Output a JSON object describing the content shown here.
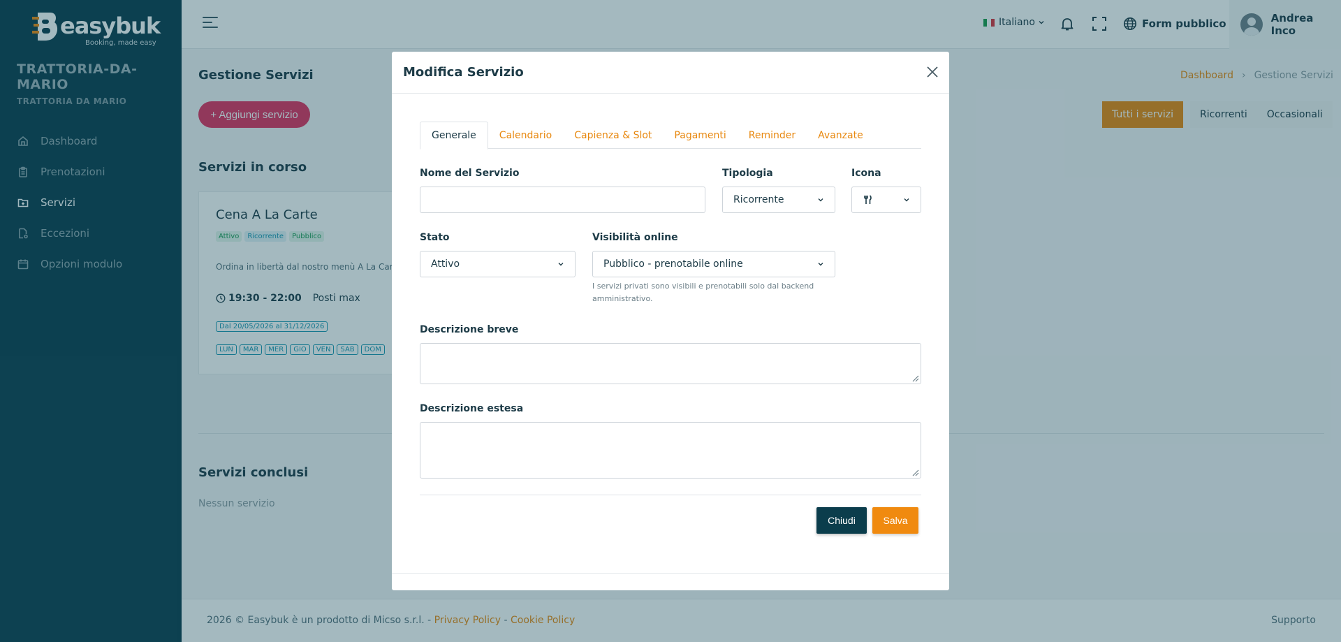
{
  "brand": {
    "logo_word": "easybuk",
    "tagline": "Booking, made easy",
    "org_title": "TRATTORIA-DA-MARIO",
    "org_subtitle": "TRATTORIA DA MARIO"
  },
  "sidebar": {
    "items": [
      {
        "label": "Dashboard",
        "icon": "home-icon"
      },
      {
        "label": "Prenotazioni",
        "icon": "clipboard-icon"
      },
      {
        "label": "Servizi",
        "icon": "folder-add-icon"
      },
      {
        "label": "Eccezioni",
        "icon": "file-gear-icon"
      },
      {
        "label": "Opzioni modulo",
        "icon": "calendar-icon"
      }
    ],
    "active": "Servizi"
  },
  "topbar": {
    "language": "Italiano",
    "public_form": "Form pubblico",
    "user_name": "Andrea Inco"
  },
  "page": {
    "title": "Gestione Servizi",
    "breadcrumb": {
      "home": "Dashboard",
      "current": "Gestione Servizi"
    },
    "add_button": "+ Aggiungi servizio",
    "filters": [
      "Tutti i servizi",
      "Ricorrenti",
      "Occasionali"
    ],
    "section_active": "Servizi in corso",
    "section_done": "Servizi conclusi",
    "empty_done": "Nessun servizio"
  },
  "service_card": {
    "name": "Cena A La Carte",
    "badges": [
      "Attivo",
      "Ricorrente",
      "Pubblico"
    ],
    "description": "Ordina in libertà dal nostro menù A La Carte",
    "time": "19:30 - 22:00",
    "capacity_label": "Posti max",
    "dates": "Dal 20/05/2026 al 31/12/2026",
    "days": [
      "LUN",
      "MAR",
      "MER",
      "GIO",
      "VEN",
      "SAB",
      "DOM"
    ]
  },
  "footer": {
    "text": "2026 © Easybuk è un prodotto di Micso s.r.l. - ",
    "privacy": "Privacy Policy",
    "dash": " - ",
    "cookie": "Cookie Policy",
    "support": "Supporto"
  },
  "modal": {
    "title": "Modifica Servizio",
    "tabs": [
      "Generale",
      "Calendario",
      "Capienza & Slot",
      "Pagamenti",
      "Reminder",
      "Avanzate"
    ],
    "active_tab": "Generale",
    "fields": {
      "name_label": "Nome del Servizio",
      "name_value": "",
      "type_label": "Tipologia",
      "type_value": "Ricorrente",
      "icon_label": "Icona",
      "icon_value": "fork-knife-icon",
      "state_label": "Stato",
      "state_value": "Attivo",
      "visibility_label": "Visibilità online",
      "visibility_value": "Pubblico - prenotabile online",
      "visibility_help": "I servizi privati sono visibili e prenotabili solo dal backend amministrativo.",
      "short_desc_label": "Descrizione breve",
      "long_desc_label": "Descrizione estesa"
    },
    "buttons": {
      "close": "Chiudi",
      "save": "Salva"
    }
  },
  "colors": {
    "sidebar_bg": "#0b3d4c",
    "accent_orange": "#e8880f",
    "add_button": "#e0305e",
    "badge_green": "#1b9a55",
    "badge_blue": "#1795b1"
  }
}
